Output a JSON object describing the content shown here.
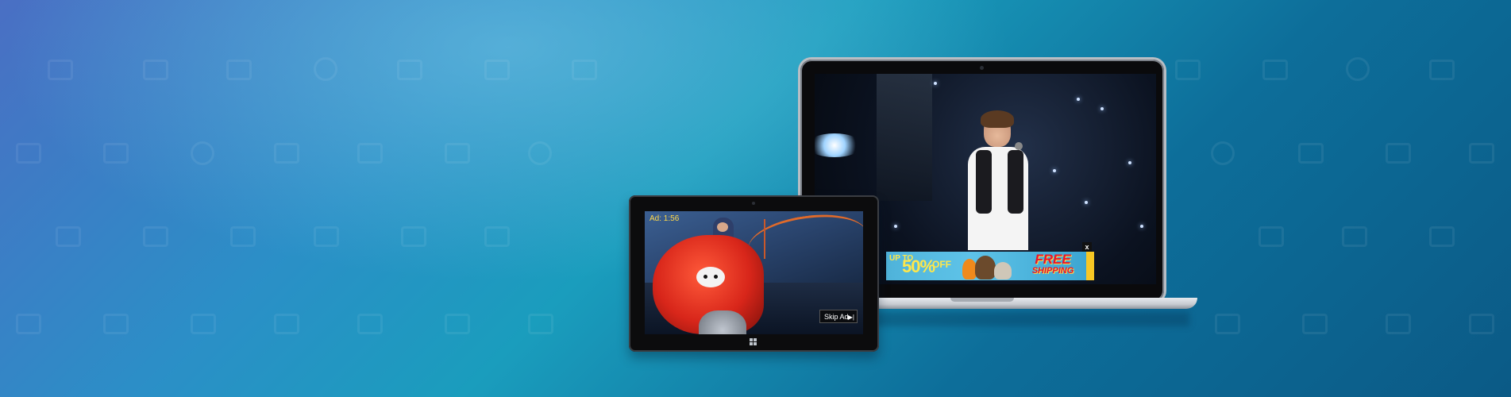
{
  "tablet_player": {
    "ad_timer": "Ad: 1:56",
    "skip_label": "Skip Ad",
    "skip_icon": "skip-next-icon"
  },
  "laptop_player": {
    "close_label": "x",
    "banner": {
      "upto": "UP TO",
      "percent": "50%",
      "off": "OFF",
      "free_line1": "FREE",
      "free_line2": "SHIPPING"
    }
  },
  "colors": {
    "background_start": "#4a6fc4",
    "background_end": "#0b5a86",
    "ad_accent": "#ffe74a",
    "free_red": "#e8162a"
  }
}
